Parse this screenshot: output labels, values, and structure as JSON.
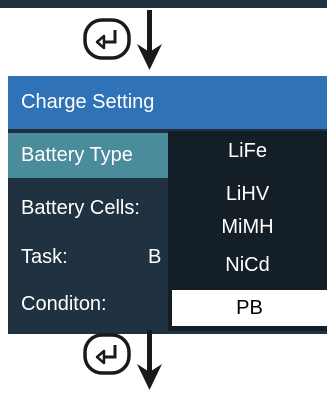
{
  "header": {
    "title": "Charge Setting"
  },
  "rows": [
    {
      "label": "Battery Type"
    },
    {
      "label": "Battery Cells:"
    },
    {
      "label": "Task:",
      "value": "B"
    },
    {
      "label": "Conditon:"
    }
  ],
  "dropdown": {
    "options": [
      "LiFe",
      "LiHV",
      "MiMH",
      "NiCd",
      "PB"
    ],
    "selected": "PB"
  },
  "icons": {
    "enter_key": "enter-key-icon",
    "arrow": "down-arrow-icon"
  },
  "colors": {
    "screen_bg": "#203141",
    "header_bg": "#2f72b8",
    "selected_row_bg": "#4a8c9c",
    "dropdown_bg": "#141e26"
  }
}
